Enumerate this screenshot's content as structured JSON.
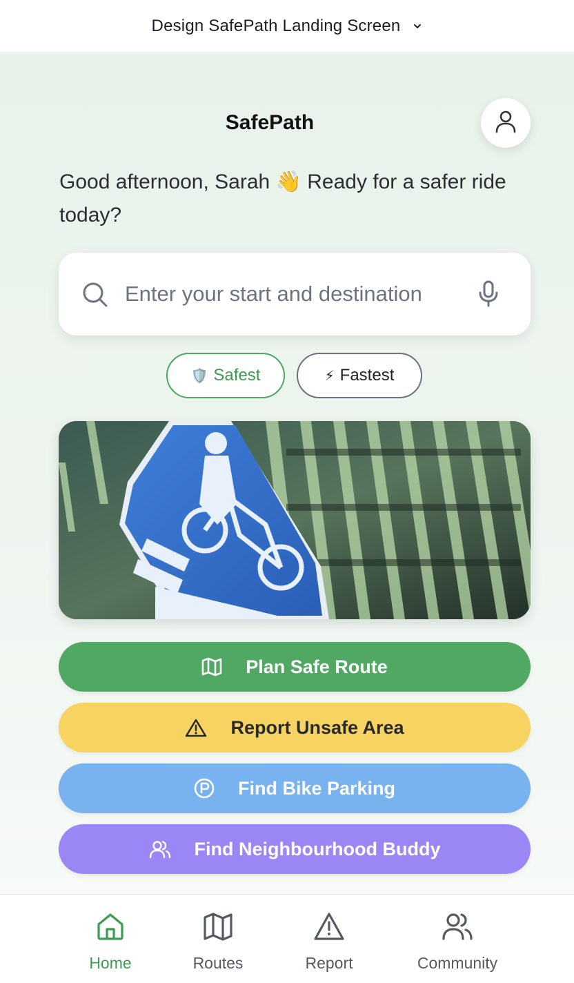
{
  "topbar": {
    "title": "Design SafePath Landing Screen"
  },
  "header": {
    "app_title": "SafePath"
  },
  "greeting": "Good afternoon, Sarah 👋 Ready for a safer ride today?",
  "search": {
    "placeholder": "Enter your start and destination"
  },
  "filters": [
    {
      "glyph": "🛡️",
      "label": "Safest",
      "selected": true
    },
    {
      "glyph": "⚡",
      "label": "Fastest",
      "selected": false
    }
  ],
  "actions": [
    {
      "label": "Plan Safe Route",
      "icon": "map-icon",
      "color": "#50a862"
    },
    {
      "label": "Report Unsafe Area",
      "icon": "warning-icon",
      "color": "#f7d462"
    },
    {
      "label": "Find Bike Parking",
      "icon": "parking-icon",
      "color": "#78b3ef"
    },
    {
      "label": "Find Neighbourhood Buddy",
      "icon": "users-icon",
      "color": "#9b86f5"
    }
  ],
  "nav": [
    {
      "label": "Home",
      "icon": "home-icon",
      "active": true
    },
    {
      "label": "Routes",
      "icon": "map-icon"
    },
    {
      "label": "Report",
      "icon": "warning-icon"
    },
    {
      "label": "Community",
      "icon": "users-icon"
    }
  ],
  "colors": {
    "accent": "#50a862",
    "warning": "#f7d462",
    "info": "#78b3ef",
    "purple": "#9b86f5"
  }
}
